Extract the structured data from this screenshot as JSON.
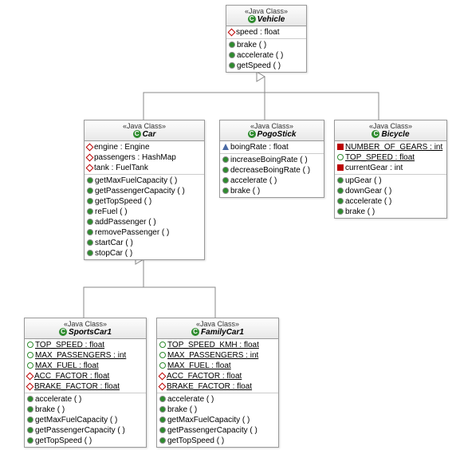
{
  "stereotype": "«Java Class»",
  "classes": {
    "vehicle": {
      "name": "Vehicle",
      "attrs": [
        {
          "vis": "protected",
          "text": "speed : float"
        }
      ],
      "ops": [
        {
          "vis": "public",
          "text": "brake ( )"
        },
        {
          "vis": "public",
          "text": "accelerate ( )"
        },
        {
          "vis": "public",
          "text": "getSpeed ( )"
        }
      ]
    },
    "car": {
      "name": "Car",
      "attrs": [
        {
          "vis": "protected",
          "text": "engine : Engine"
        },
        {
          "vis": "protected",
          "text": "passengers : HashMap"
        },
        {
          "vis": "protected",
          "text": "tank : FuelTank"
        }
      ],
      "ops": [
        {
          "vis": "public",
          "text": "getMaxFuelCapacity ( )"
        },
        {
          "vis": "public",
          "text": "getPassengerCapacity ( )"
        },
        {
          "vis": "public",
          "text": "getTopSpeed ( )"
        },
        {
          "vis": "public",
          "text": "reFuel ( )"
        },
        {
          "vis": "public",
          "text": "addPassenger ( )"
        },
        {
          "vis": "public",
          "text": "removePassenger ( )"
        },
        {
          "vis": "public",
          "text": "startCar ( )"
        },
        {
          "vis": "public",
          "text": "stopCar ( )"
        }
      ]
    },
    "pogo": {
      "name": "PogoStick",
      "attrs": [
        {
          "vis": "triangle",
          "text": "boingRate : float"
        }
      ],
      "ops": [
        {
          "vis": "public",
          "text": "increaseBoingRate ( )"
        },
        {
          "vis": "public",
          "text": "decreaseBoingRate ( )"
        },
        {
          "vis": "public",
          "text": "accelerate ( )"
        },
        {
          "vis": "public",
          "text": "brake ( )"
        }
      ]
    },
    "bicycle": {
      "name": "Bicycle",
      "attrs": [
        {
          "vis": "private",
          "text": "NUMBER_OF_GEARS : int",
          "static": true
        },
        {
          "vis": "pub-open",
          "text": "TOP_SPEED : float",
          "static": true
        },
        {
          "vis": "private",
          "text": "currentGear : int"
        }
      ],
      "ops": [
        {
          "vis": "public",
          "text": "upGear ( )"
        },
        {
          "vis": "public",
          "text": "downGear ( )"
        },
        {
          "vis": "public",
          "text": "accelerate ( )"
        },
        {
          "vis": "public",
          "text": "brake ( )"
        }
      ]
    },
    "sports": {
      "name": "SportsCar1",
      "attrs": [
        {
          "vis": "pub-open",
          "text": "TOP_SPEED : float",
          "static": true
        },
        {
          "vis": "pub-open",
          "text": "MAX_PASSENGERS : int",
          "static": true
        },
        {
          "vis": "pub-open",
          "text": "MAX_FUEL : float",
          "static": true
        },
        {
          "vis": "protected",
          "text": "ACC_FACTOR : float",
          "static": true
        },
        {
          "vis": "protected",
          "text": "BRAKE_FACTOR : float",
          "static": true
        }
      ],
      "ops": [
        {
          "vis": "public",
          "text": "accelerate ( )"
        },
        {
          "vis": "public",
          "text": "brake ( )"
        },
        {
          "vis": "public",
          "text": "getMaxFuelCapacity ( )"
        },
        {
          "vis": "public",
          "text": "getPassengerCapacity ( )"
        },
        {
          "vis": "public",
          "text": "getTopSpeed ( )"
        }
      ]
    },
    "family": {
      "name": "FamilyCar1",
      "attrs": [
        {
          "vis": "pub-open",
          "text": "TOP_SPEED_KMH : float",
          "static": true
        },
        {
          "vis": "pub-open",
          "text": "MAX_PASSENGERS : int",
          "static": true
        },
        {
          "vis": "pub-open",
          "text": "MAX_FUEL : float",
          "static": true
        },
        {
          "vis": "protected",
          "text": "ACC_FACTOR : float",
          "static": true
        },
        {
          "vis": "protected",
          "text": "BRAKE_FACTOR : float",
          "static": true
        }
      ],
      "ops": [
        {
          "vis": "public",
          "text": "accelerate ( )"
        },
        {
          "vis": "public",
          "text": "brake ( )"
        },
        {
          "vis": "public",
          "text": "getMaxFuelCapacity ( )"
        },
        {
          "vis": "public",
          "text": "getPassengerCapacity ( )"
        },
        {
          "vis": "public",
          "text": "getTopSpeed ( )"
        }
      ]
    }
  },
  "chart_data": {
    "type": "table",
    "description": "UML class diagram",
    "root": "Vehicle",
    "inheritance": [
      {
        "child": "Car",
        "parent": "Vehicle"
      },
      {
        "child": "PogoStick",
        "parent": "Vehicle"
      },
      {
        "child": "Bicycle",
        "parent": "Vehicle"
      },
      {
        "child": "SportsCar1",
        "parent": "Car"
      },
      {
        "child": "FamilyCar1",
        "parent": "Car"
      }
    ]
  }
}
